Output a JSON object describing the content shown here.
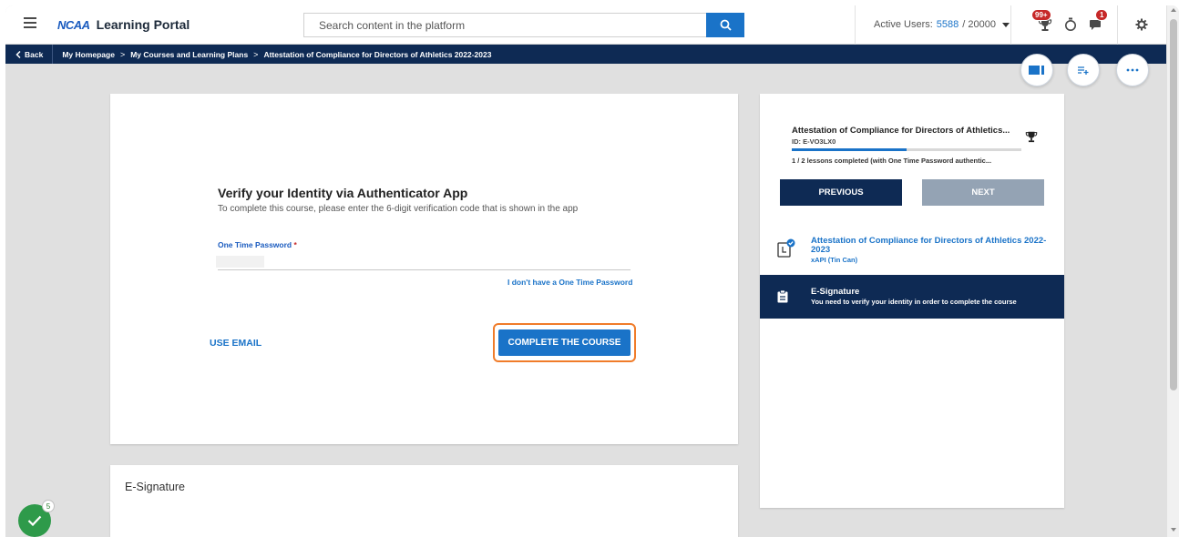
{
  "header": {
    "logo": "NCAA",
    "portal_name": "Learning Portal",
    "search_placeholder": "Search content in the platform",
    "active_users_label": "Active Users:",
    "active_users_count": "5588",
    "active_users_total": "/ 20000",
    "notifications_badge": "99+",
    "messages_badge": "1"
  },
  "navbar": {
    "back_label": "Back",
    "crumbs": [
      "My Homepage",
      "My Courses and Learning Plans",
      "Attestation of Compliance for Directors of Athletics 2022-2023"
    ],
    "separator": ">"
  },
  "main": {
    "verify_title": "Verify your Identity via Authenticator App",
    "verify_subtitle": "To complete this course, please enter the 6-digit verification code that is shown in the app",
    "otp_label": "One Time Password",
    "otp_required_mark": "*",
    "no_otp_link": "I don't have a One Time Password",
    "use_email_label": "USE EMAIL",
    "complete_label": "COMPLETE THE COURSE"
  },
  "esignature_card": {
    "title": "E-Signature"
  },
  "side_panel": {
    "course_title": "Attestation of Compliance for Directors of Athletics...",
    "course_id": "ID: E-VO3LX0",
    "progress_fraction": 0.5,
    "progress_text": "1 / 2 lessons completed (with One Time Password authentic...",
    "previous_label": "PREVIOUS",
    "next_label": "NEXT",
    "lessons": [
      {
        "title": "Attestation of Compliance for Directors of Athletics 2022-2023",
        "type": "xAPI (Tin Can)"
      },
      {
        "title": "E-Signature",
        "subtitle": "You need to verify your identity in order to complete the course"
      }
    ]
  },
  "checklist_badge": "5",
  "colors": {
    "primary": "#1a73c8",
    "navy": "#0e2a54",
    "highlight": "#f07c2a",
    "success": "#2e9a4a"
  }
}
